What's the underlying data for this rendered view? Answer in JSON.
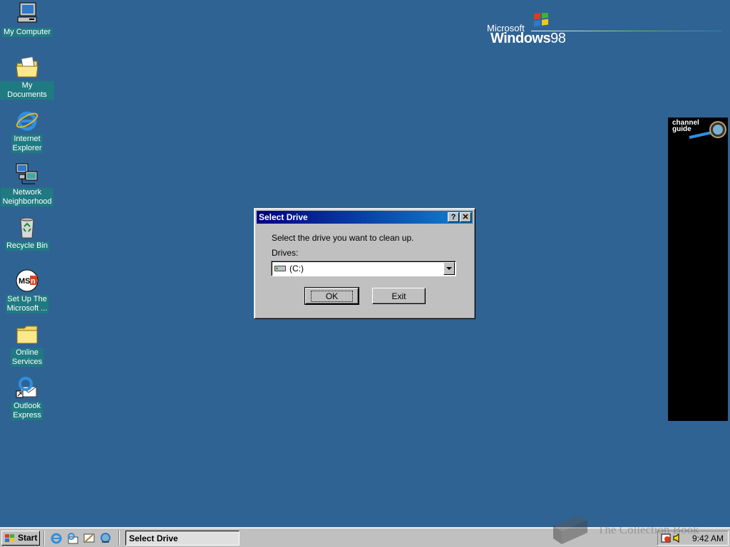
{
  "desktop": {
    "icons": [
      {
        "label": "My Computer",
        "icon": "my-computer-icon"
      },
      {
        "label": "My Documents",
        "icon": "my-documents-icon"
      },
      {
        "label": "Internet\nExplorer",
        "icon": "internet-explorer-icon"
      },
      {
        "label": "Network\nNeighborhood",
        "icon": "network-neighborhood-icon"
      },
      {
        "label": "Recycle Bin",
        "icon": "recycle-bin-icon"
      },
      {
        "label": "Set Up The\nMicrosoft ...",
        "icon": "msn-icon"
      },
      {
        "label": "Online\nServices",
        "icon": "online-services-folder-icon"
      },
      {
        "label": "Outlook\nExpress",
        "icon": "outlook-express-icon"
      }
    ],
    "background_color": "#2f6393"
  },
  "branding": {
    "microsoft": "Microsoft",
    "windows": "Windows",
    "version": "98"
  },
  "channel_bar": {
    "title_line1": "channel",
    "title_line2": "guide"
  },
  "dialog": {
    "title": "Select Drive",
    "help_button": "?",
    "close_button": "✕",
    "prompt": "Select the drive you want to clean up.",
    "drives_label": "Drives:",
    "selected_drive": "(C:)",
    "ok_label": "OK",
    "exit_label": "Exit"
  },
  "taskbar": {
    "start_label": "Start",
    "task_label": "Select Drive",
    "clock": "9:42 AM",
    "quick_launch": [
      "internet-explorer-icon",
      "outlook-express-icon",
      "show-desktop-icon",
      "channels-icon"
    ]
  },
  "watermark": {
    "text": "The Collection Book"
  },
  "colors": {
    "titlebar_start": "#000080",
    "titlebar_end": "#1084d0",
    "face": "#c0c0c0",
    "label_bg": "#1f7a82"
  }
}
